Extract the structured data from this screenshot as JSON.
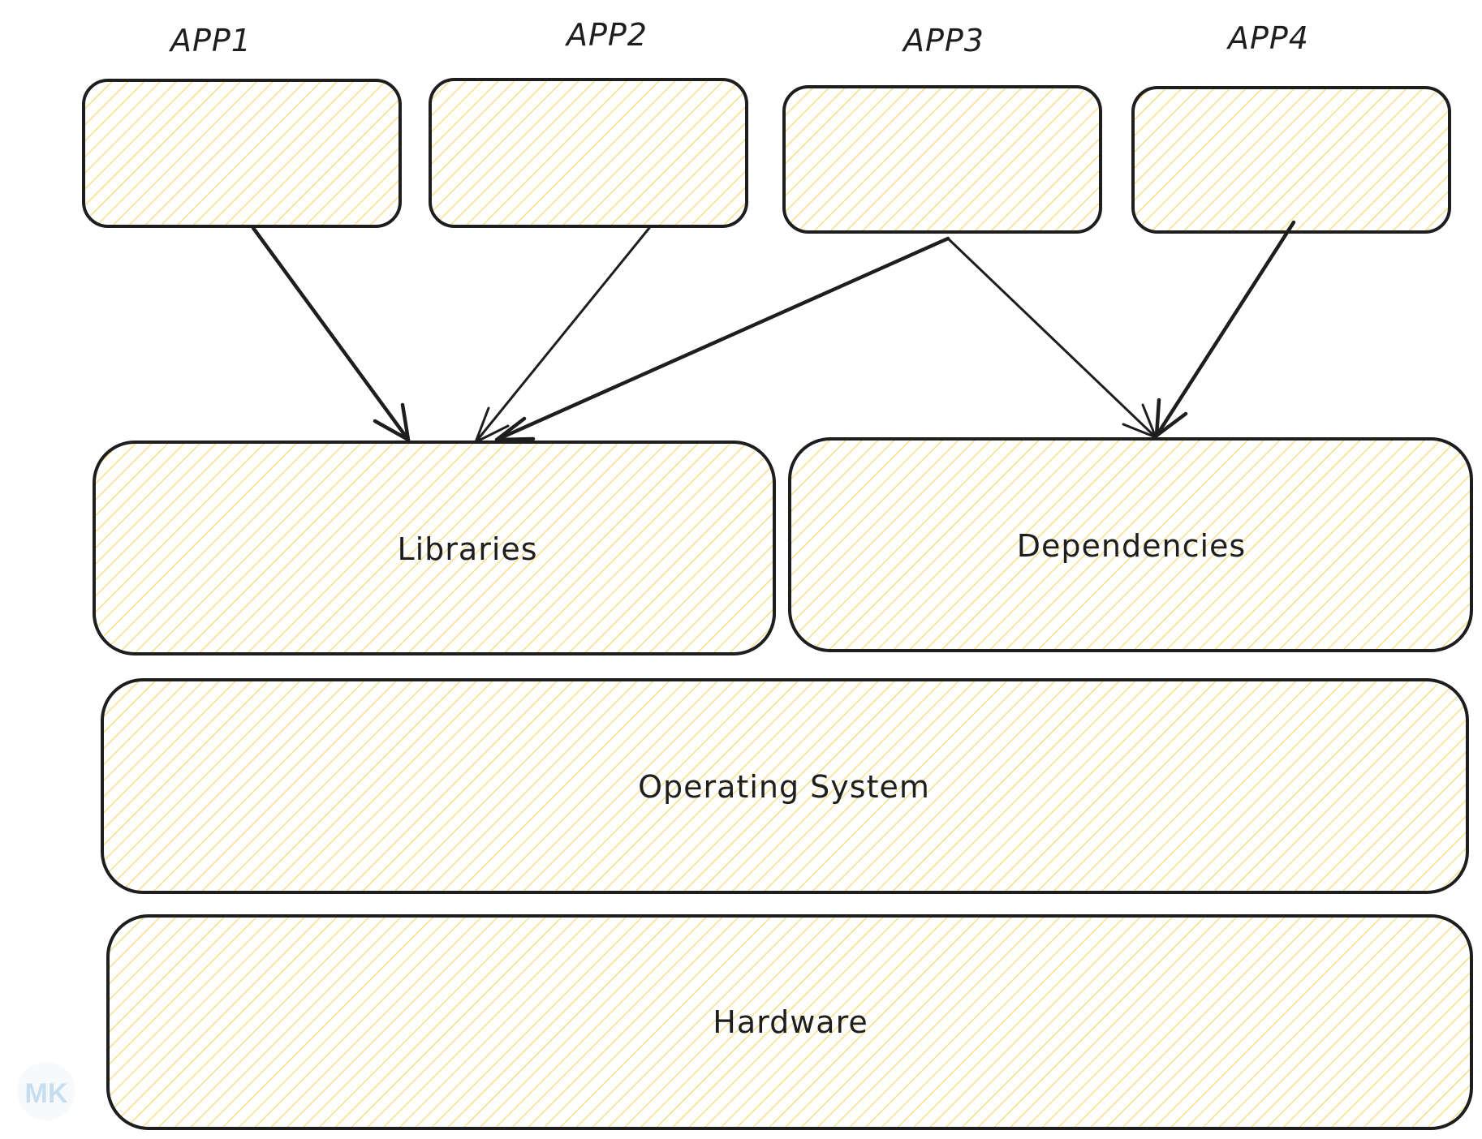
{
  "diagram": {
    "apps": [
      {
        "id": "app1",
        "label": "APP1"
      },
      {
        "id": "app2",
        "label": "APP2"
      },
      {
        "id": "app3",
        "label": "APP3"
      },
      {
        "id": "app4",
        "label": "APP4"
      }
    ],
    "layers": [
      {
        "id": "libraries",
        "label": "Libraries"
      },
      {
        "id": "dependencies",
        "label": "Dependencies"
      },
      {
        "id": "operating-system",
        "label": "Operating System"
      },
      {
        "id": "hardware",
        "label": "Hardware"
      }
    ],
    "connections": [
      {
        "from": "app1",
        "to": "libraries"
      },
      {
        "from": "app2",
        "to": "libraries"
      },
      {
        "from": "app3",
        "to": "libraries"
      },
      {
        "from": "app3",
        "to": "dependencies"
      },
      {
        "from": "app4",
        "to": "dependencies"
      }
    ]
  },
  "watermark": {
    "text": "MK",
    "colors": [
      "#4aa3df",
      "#e57373"
    ]
  },
  "colors": {
    "fill": "#fbe9a0",
    "stroke": "#1e1e1e",
    "background": "#ffffff"
  }
}
